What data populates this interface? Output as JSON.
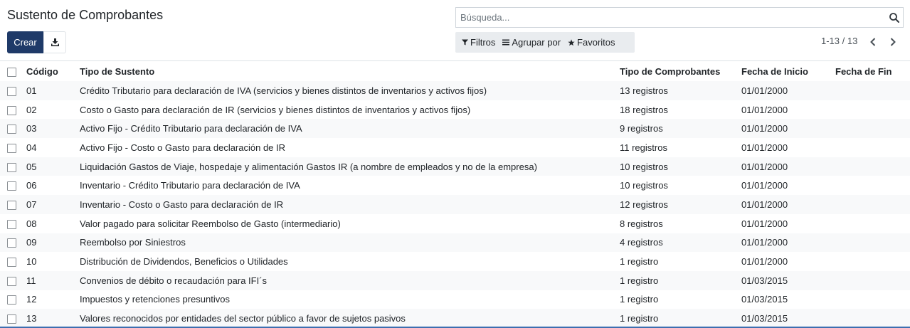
{
  "header": {
    "title": "Sustento de Comprobantes",
    "create_label": "Crear",
    "download_icon": "download-icon"
  },
  "search": {
    "placeholder": "Búsqueda...",
    "value": "",
    "icon": "search-icon"
  },
  "filters": {
    "filters_label": "Filtros",
    "group_label": "Agrupar por",
    "favorites_label": "Favoritos"
  },
  "pager": {
    "range": "1-13 / 13"
  },
  "table": {
    "columns": [
      "Código",
      "Tipo de Sustento",
      "Tipo de Comprobantes",
      "Fecha de Inicio",
      "Fecha de Fin"
    ],
    "rows": [
      {
        "code": "01",
        "tipo": "Crédito Tributario para declaración de IVA (servicios y bienes distintos de inventarios y activos fijos)",
        "comprobantes": "13 registros",
        "inicio": "01/01/2000",
        "fin": ""
      },
      {
        "code": "02",
        "tipo": "Costo o Gasto para declaración de IR (servicios y bienes distintos de inventarios y activos fijos)",
        "comprobantes": "18 registros",
        "inicio": "01/01/2000",
        "fin": ""
      },
      {
        "code": "03",
        "tipo": "Activo Fijo - Crédito Tributario para declaración de IVA",
        "comprobantes": "9 registros",
        "inicio": "01/01/2000",
        "fin": ""
      },
      {
        "code": "04",
        "tipo": "Activo Fijo - Costo o Gasto para declaración de IR",
        "comprobantes": "11 registros",
        "inicio": "01/01/2000",
        "fin": ""
      },
      {
        "code": "05",
        "tipo": "Liquidación Gastos de Viaje, hospedaje y alimentación Gastos IR (a nombre de empleados y no de la empresa)",
        "comprobantes": "10 registros",
        "inicio": "01/01/2000",
        "fin": ""
      },
      {
        "code": "06",
        "tipo": "Inventario - Crédito Tributario para declaración de IVA",
        "comprobantes": "10 registros",
        "inicio": "01/01/2000",
        "fin": ""
      },
      {
        "code": "07",
        "tipo": "Inventario - Costo o Gasto para declaración de IR",
        "comprobantes": "12 registros",
        "inicio": "01/01/2000",
        "fin": ""
      },
      {
        "code": "08",
        "tipo": "Valor pagado para solicitar Reembolso de Gasto (intermediario)",
        "comprobantes": "8 registros",
        "inicio": "01/01/2000",
        "fin": ""
      },
      {
        "code": "09",
        "tipo": "Reembolso por Siniestros",
        "comprobantes": "4 registros",
        "inicio": "01/01/2000",
        "fin": ""
      },
      {
        "code": "10",
        "tipo": "Distribución de Dividendos, Beneficios o Utilidades",
        "comprobantes": "1 registro",
        "inicio": "01/01/2000",
        "fin": ""
      },
      {
        "code": "11",
        "tipo": "Convenios de débito o recaudación para IFI´s",
        "comprobantes": "1 registro",
        "inicio": "01/03/2015",
        "fin": ""
      },
      {
        "code": "12",
        "tipo": "Impuestos y retenciones presuntivos",
        "comprobantes": "1 registro",
        "inicio": "01/03/2015",
        "fin": ""
      },
      {
        "code": "13",
        "tipo": "Valores reconocidos por entidades del sector público a favor de sujetos pasivos",
        "comprobantes": "1 registro",
        "inicio": "01/03/2015",
        "fin": ""
      }
    ]
  },
  "colors": {
    "primary": "#1f3a68",
    "row_stripe": "#f8f9fa",
    "filter_bg": "#e9ecef"
  }
}
